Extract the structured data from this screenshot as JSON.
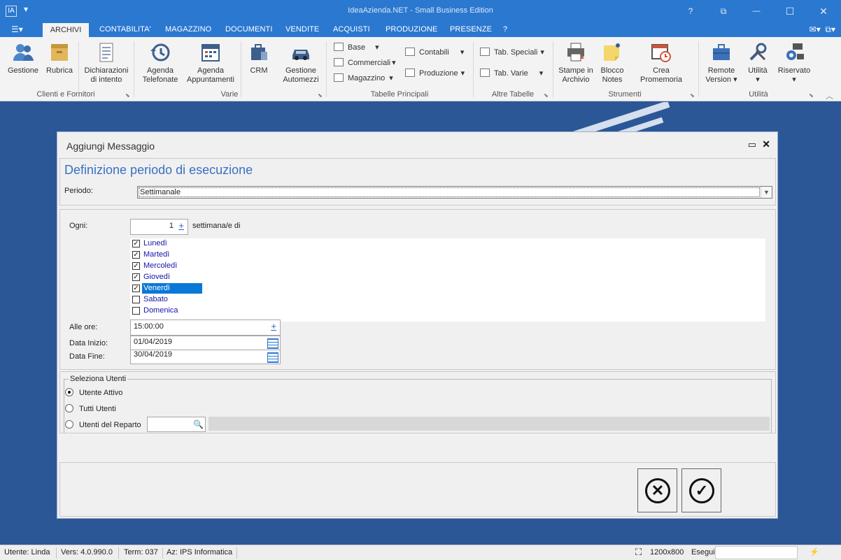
{
  "window": {
    "title": "IdeaAzienda.NET - Small Business Edition",
    "logo_text": "IA",
    "controls": {
      "help": "?",
      "restore": "⧉",
      "minimize": "—",
      "maximize": "☐",
      "close": "✕"
    }
  },
  "menu": {
    "app_menu_icon": "document-icon",
    "tabs": [
      "ARCHIVI",
      "CONTABILITA'",
      "MAGAZZINO",
      "DOCUMENTI",
      "VENDITE",
      "ACQUISTI",
      "PRODUZIONE",
      "PRESENZE",
      "?"
    ],
    "active_tab": "ARCHIVI"
  },
  "ribbon": {
    "groups": [
      {
        "label": "Clienti e Fornitori"
      },
      {
        "label": "Varie"
      },
      {
        "label": "Tabelle Principali"
      },
      {
        "label": "Altre Tabelle"
      },
      {
        "label": "Strumenti"
      },
      {
        "label": "Utilità"
      }
    ],
    "buttons": {
      "gestione": "Gestione",
      "rubrica": "Rubrica",
      "dichiarazioni_1": "Dichiarazioni",
      "dichiarazioni_2": "di intento",
      "agenda_tel_1": "Agenda",
      "agenda_tel_2": "Telefonate",
      "agenda_app_1": "Agenda",
      "agenda_app_2": "Appuntamenti",
      "crm": "CRM",
      "automezzi_1": "Gestione",
      "automezzi_2": "Automezzi",
      "base": "Base",
      "commerciali": "Commerciali",
      "magazzino": "Magazzino",
      "contabili": "Contabili",
      "produzione": "Produzione",
      "tab_speciali": "Tab. Speciali",
      "tab_varie": "Tab. Varie",
      "stampe_1": "Stampe in",
      "stampe_2": "Archivio",
      "blocco_1": "Blocco",
      "blocco_2": "Notes",
      "promemoria": "Crea Promemoria",
      "remote_1": "Remote",
      "remote_2": "Version",
      "utilita": "Utilità",
      "riservato": "Riservato"
    }
  },
  "dialog": {
    "title": "Aggiungi Messaggio",
    "heading": "Definizione periodo di esecuzione",
    "periodo_label": "Periodo:",
    "periodo_value": "Settimanale",
    "ogni_label": "Ogni:",
    "ogni_value": "1",
    "ogni_suffix": "settimana/e di",
    "days": [
      {
        "label": "Lunedì",
        "checked": true
      },
      {
        "label": "Martedì",
        "checked": true
      },
      {
        "label": "Mercoledì",
        "checked": true
      },
      {
        "label": "Giovedì",
        "checked": true
      },
      {
        "label": "Venerdì",
        "checked": true,
        "selected": true
      },
      {
        "label": "Sabato",
        "checked": false
      },
      {
        "label": "Domenica",
        "checked": false
      }
    ],
    "alle_ore_label": "Alle ore:",
    "alle_ore_value": "15:00:00",
    "data_inizio_label": "Data Inizio:",
    "data_inizio_value": "01/04/2019",
    "data_fine_label": "Data Fine:",
    "data_fine_value": "30/04/2019",
    "users_group_label": "Seleziona Utenti",
    "user_options": [
      {
        "label": "Utente Attivo",
        "selected": true
      },
      {
        "label": "Tutti Utenti",
        "selected": false
      },
      {
        "label": "Utenti del Reparto",
        "selected": false
      }
    ],
    "plus_sign": "+",
    "cancel_symbol": "✕",
    "ok_symbol": "✓"
  },
  "statusbar": {
    "user": "Utente: Linda",
    "version": "Vers: 4.0.990.0",
    "term": "Term: 037",
    "company": "Az: IPS Informatica",
    "resolution": "1200x800",
    "esegui": "Esegui",
    "bolt": "⚡"
  },
  "colors": {
    "accent": "#2b78d0",
    "background": "#2b5797",
    "heading": "#3a70c4",
    "selection": "#0a78d7"
  }
}
